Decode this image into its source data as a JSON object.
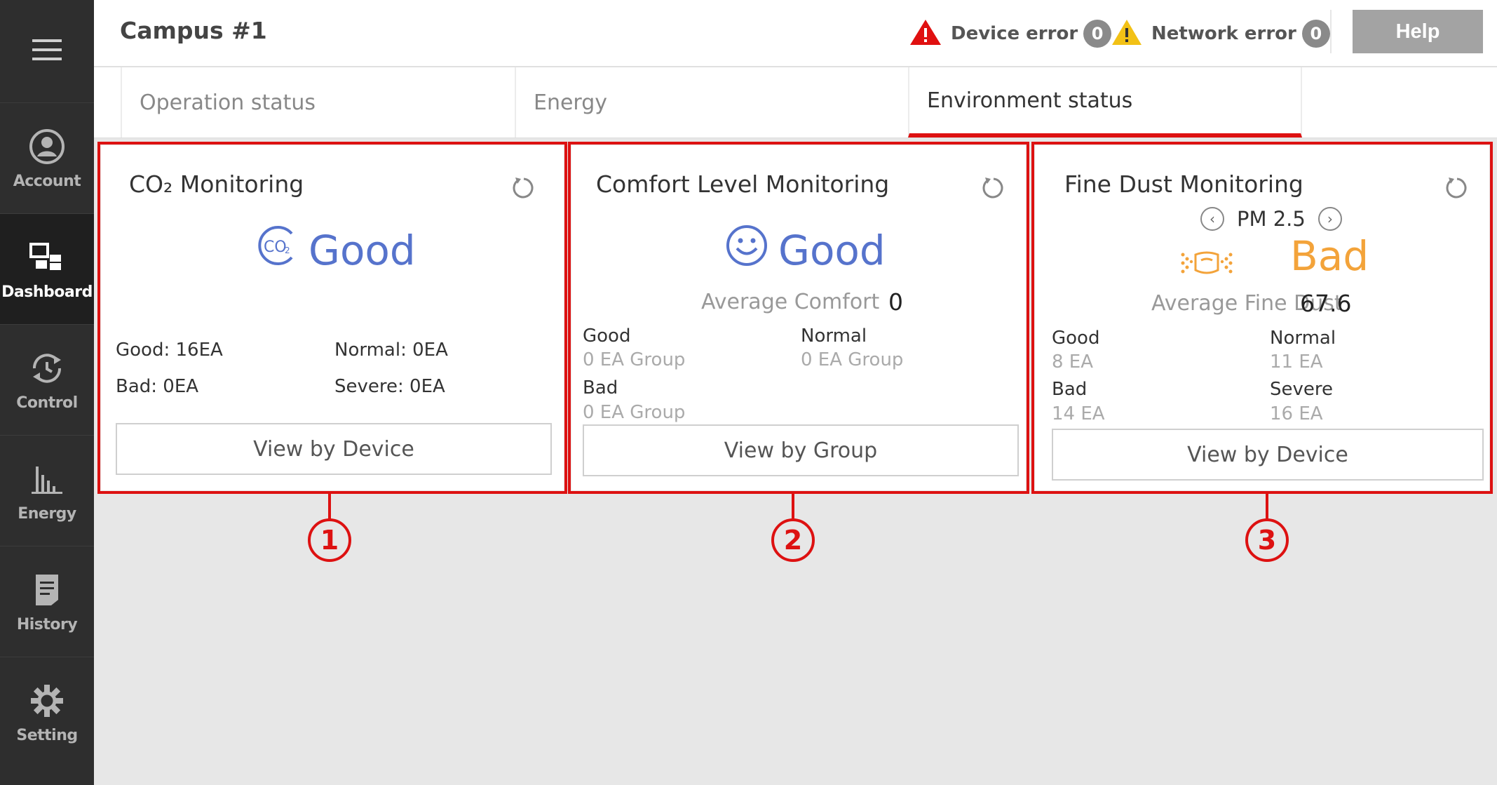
{
  "sidebar": {
    "menu_icon": "hamburger-icon",
    "items": [
      {
        "label": "Account",
        "icon": "account-icon",
        "active": false
      },
      {
        "label": "Dashboard",
        "icon": "dashboard-icon",
        "active": true
      },
      {
        "label": "Control",
        "icon": "control-icon",
        "active": false
      },
      {
        "label": "Energy",
        "icon": "energy-chart-icon",
        "active": false
      },
      {
        "label": "History",
        "icon": "history-icon",
        "active": false
      },
      {
        "label": "Setting",
        "icon": "gear-icon",
        "active": false
      }
    ]
  },
  "header": {
    "title": "Campus #1",
    "device_error": {
      "label": "Device error",
      "count": "0",
      "icon": "red-warning-icon"
    },
    "network_error": {
      "label": "Network error",
      "count": "0",
      "icon": "yellow-warning-icon"
    },
    "help_label": "Help"
  },
  "tabs": [
    {
      "label": "Operation status",
      "active": false
    },
    {
      "label": "Energy",
      "active": false
    },
    {
      "label": "Environment status",
      "active": true
    }
  ],
  "cards": {
    "co2": {
      "title": "CO₂ Monitoring",
      "status": "Good",
      "status_icon": "co2-icon",
      "good": "Good: 16EA",
      "normal": "Normal: 0EA",
      "bad": "Bad: 0EA",
      "severe": "Severe: 0EA",
      "button": "View by Device",
      "callout": "1"
    },
    "comfort": {
      "title": "Comfort Level Monitoring",
      "status": "Good",
      "status_icon": "smile-icon",
      "avg_label": "Average Comfort",
      "avg_value": "0",
      "good_label": "Good",
      "good_value": "0 EA Group",
      "normal_label": "Normal",
      "normal_value": "0 EA Group",
      "bad_label": "Bad",
      "bad_value": "0 EA Group",
      "button": "View by Group",
      "callout": "2"
    },
    "dust": {
      "title": "Fine Dust Monitoring",
      "pm_label": "PM 2.5",
      "status": "Bad",
      "status_icon": "dust-mask-icon",
      "avg_label": "Average Fine Dust",
      "avg_value": "67.6",
      "good_label": "Good",
      "good_value": "8 EA",
      "normal_label": "Normal",
      "normal_value": "11 EA",
      "bad_label": "Bad",
      "bad_value": "14 EA",
      "severe_label": "Severe",
      "severe_value": "16 EA",
      "button": "View by Device",
      "callout": "3"
    }
  },
  "colors": {
    "sidebar_bg": "#2e2e2e",
    "accent_red": "#dd1111",
    "status_blue": "#5673cc",
    "status_orange": "#f3a33a",
    "content_bg": "#e7e7e7"
  }
}
